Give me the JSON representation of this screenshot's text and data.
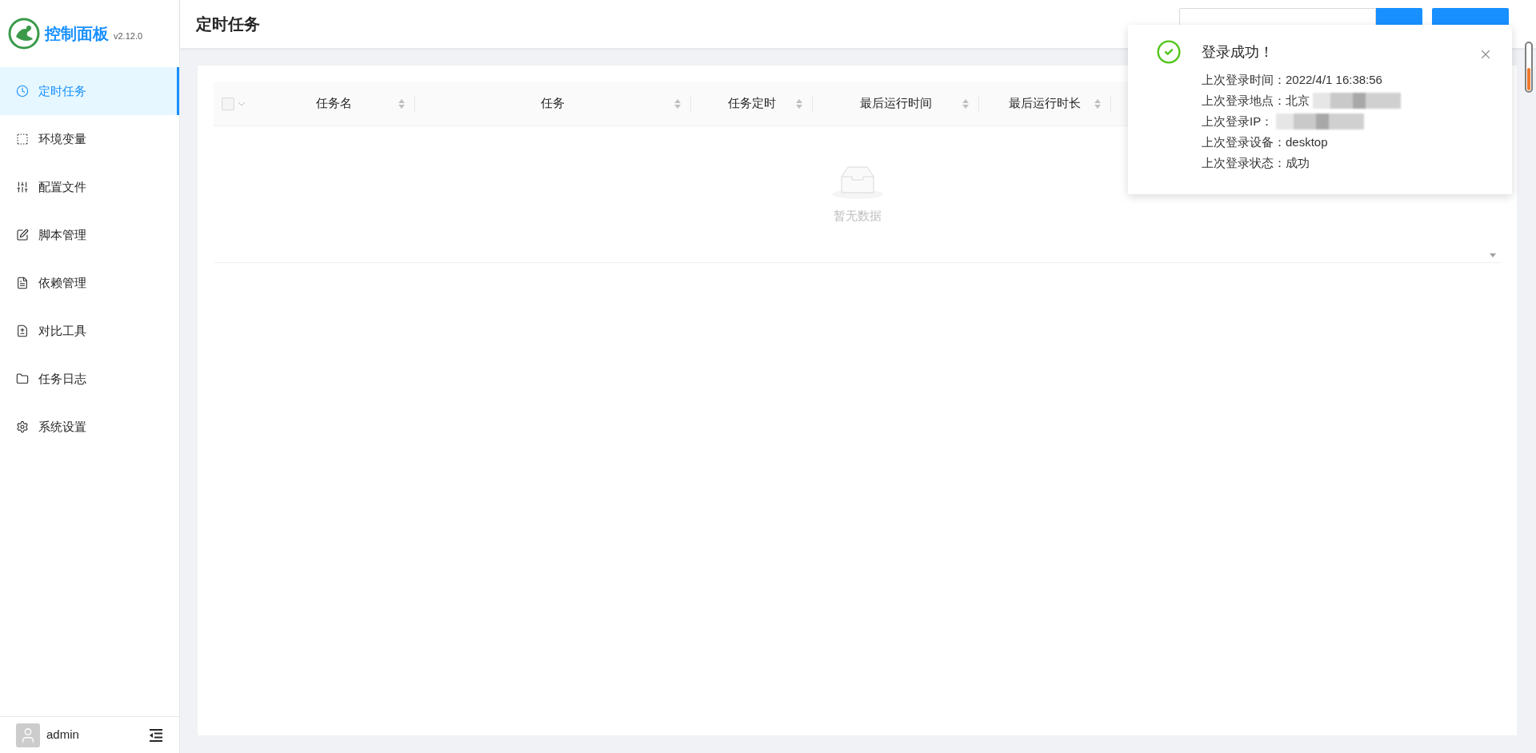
{
  "sidebar": {
    "logo": {
      "title": "控制面板",
      "version": "v2.12.0"
    },
    "items": [
      {
        "label": "定时任务",
        "selected": true
      },
      {
        "label": "环境变量",
        "selected": false
      },
      {
        "label": "配置文件",
        "selected": false
      },
      {
        "label": "脚本管理",
        "selected": false
      },
      {
        "label": "依赖管理",
        "selected": false
      },
      {
        "label": "对比工具",
        "selected": false
      },
      {
        "label": "任务日志",
        "selected": false
      },
      {
        "label": "系统设置",
        "selected": false
      }
    ],
    "footer": {
      "user": "admin"
    }
  },
  "header": {
    "title": "定时任务"
  },
  "table": {
    "select_all": {
      "checked": false
    },
    "columns": [
      "任务名",
      "任务",
      "任务定时",
      "最后运行时间",
      "最后运行时长"
    ],
    "empty_text": "暂无数据"
  },
  "notification": {
    "title": "登录成功！",
    "lines": [
      {
        "label": "上次登录时间：",
        "value": "2022/4/1 16:38:56",
        "redacted": false
      },
      {
        "label": "上次登录地点：",
        "value": "北京",
        "redacted": true
      },
      {
        "label": "上次登录IP：",
        "redacted": true
      },
      {
        "label": "上次登录设备：",
        "value": "desktop",
        "redacted": false
      },
      {
        "label": "上次登录状态：",
        "value": "成功",
        "redacted": false
      }
    ]
  }
}
